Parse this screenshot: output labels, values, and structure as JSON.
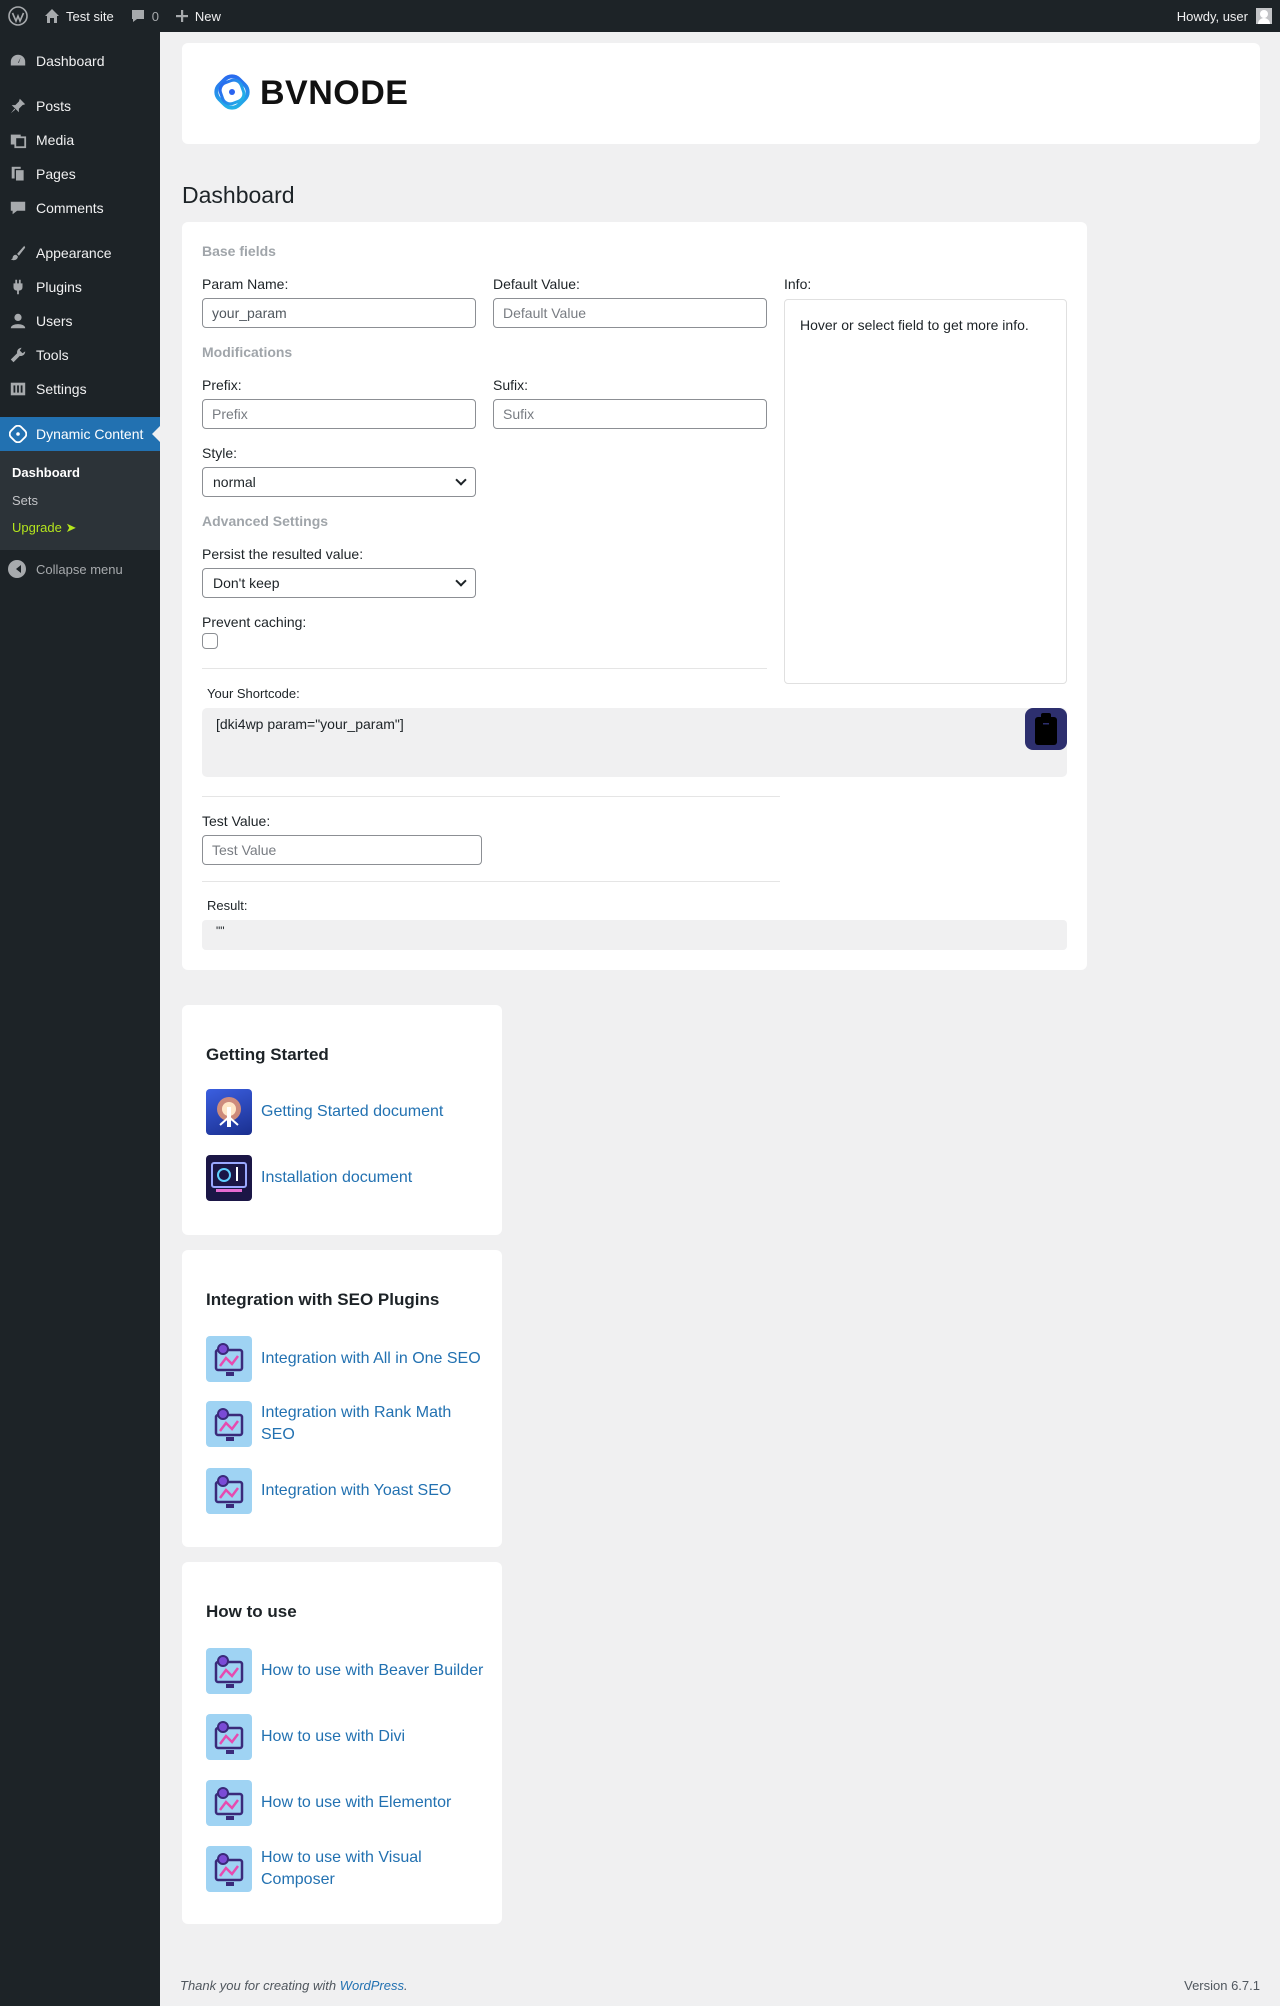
{
  "adminbar": {
    "site_name": "Test site",
    "comments_count": "0",
    "new_label": "New",
    "howdy": "Howdy, user"
  },
  "sidebar": {
    "items": [
      {
        "label": "Dashboard",
        "icon": "dashboard-icon"
      },
      {
        "label": "Posts",
        "icon": "pin-icon"
      },
      {
        "label": "Media",
        "icon": "media-icon"
      },
      {
        "label": "Pages",
        "icon": "pages-icon"
      },
      {
        "label": "Comments",
        "icon": "comment-icon"
      },
      {
        "label": "Appearance",
        "icon": "brush-icon"
      },
      {
        "label": "Plugins",
        "icon": "plug-icon"
      },
      {
        "label": "Users",
        "icon": "user-icon"
      },
      {
        "label": "Tools",
        "icon": "wrench-icon"
      },
      {
        "label": "Settings",
        "icon": "settings-icon"
      },
      {
        "label": "Dynamic Content",
        "icon": "bvnode-icon"
      }
    ],
    "submenu": {
      "dashboard": "Dashboard",
      "sets": "Sets",
      "upgrade": "Upgrade ➤"
    },
    "collapse": "Collapse menu"
  },
  "brand": {
    "name": "BVNODE"
  },
  "page": {
    "title": "Dashboard"
  },
  "form": {
    "base_fields": "Base fields",
    "param_name_label": "Param Name:",
    "param_name_value": "your_param",
    "default_value_label": "Default Value:",
    "default_value_placeholder": "Default Value",
    "info_label": "Info:",
    "info_text": "Hover or select field to get more info.",
    "modifications": "Modifications",
    "prefix_label": "Prefix:",
    "prefix_placeholder": "Prefix",
    "sufix_label": "Sufix:",
    "sufix_placeholder": "Sufix",
    "style_label": "Style:",
    "style_value": "normal",
    "advanced": "Advanced Settings",
    "persist_label": "Persist the resulted value:",
    "persist_value": "Don't keep",
    "prevent_label": "Prevent caching:",
    "shortcode_label": "Your Shortcode:",
    "shortcode_value": "[dki4wp param=\"your_param\"]",
    "test_value_label": "Test Value:",
    "test_value_placeholder": "Test Value",
    "result_label": "Result:",
    "result_value": "\"\""
  },
  "resources": {
    "getting_started": {
      "title": "Getting Started",
      "items": [
        "Getting Started document",
        "Installation document"
      ]
    },
    "seo": {
      "title": "Integration with SEO Plugins",
      "items": [
        "Integration with All in One SEO",
        "Integration with Rank Math SEO",
        "Integration with Yoast SEO"
      ]
    },
    "how_to": {
      "title": "How to use",
      "items": [
        "How to use with Beaver Builder",
        "How to use with Divi",
        "How to use with Elementor",
        "How to use with Visual Composer"
      ]
    }
  },
  "footer": {
    "thanks_prefix": "Thank you for creating with ",
    "wordpress": "WordPress",
    "thanks_suffix": ".",
    "version": "Version 6.7.1"
  },
  "colors": {
    "accent": "#2271b1",
    "sidebar_bg": "#1d2327",
    "upgrade": "#b5e61d",
    "copy_button": "#2d2f6e"
  }
}
